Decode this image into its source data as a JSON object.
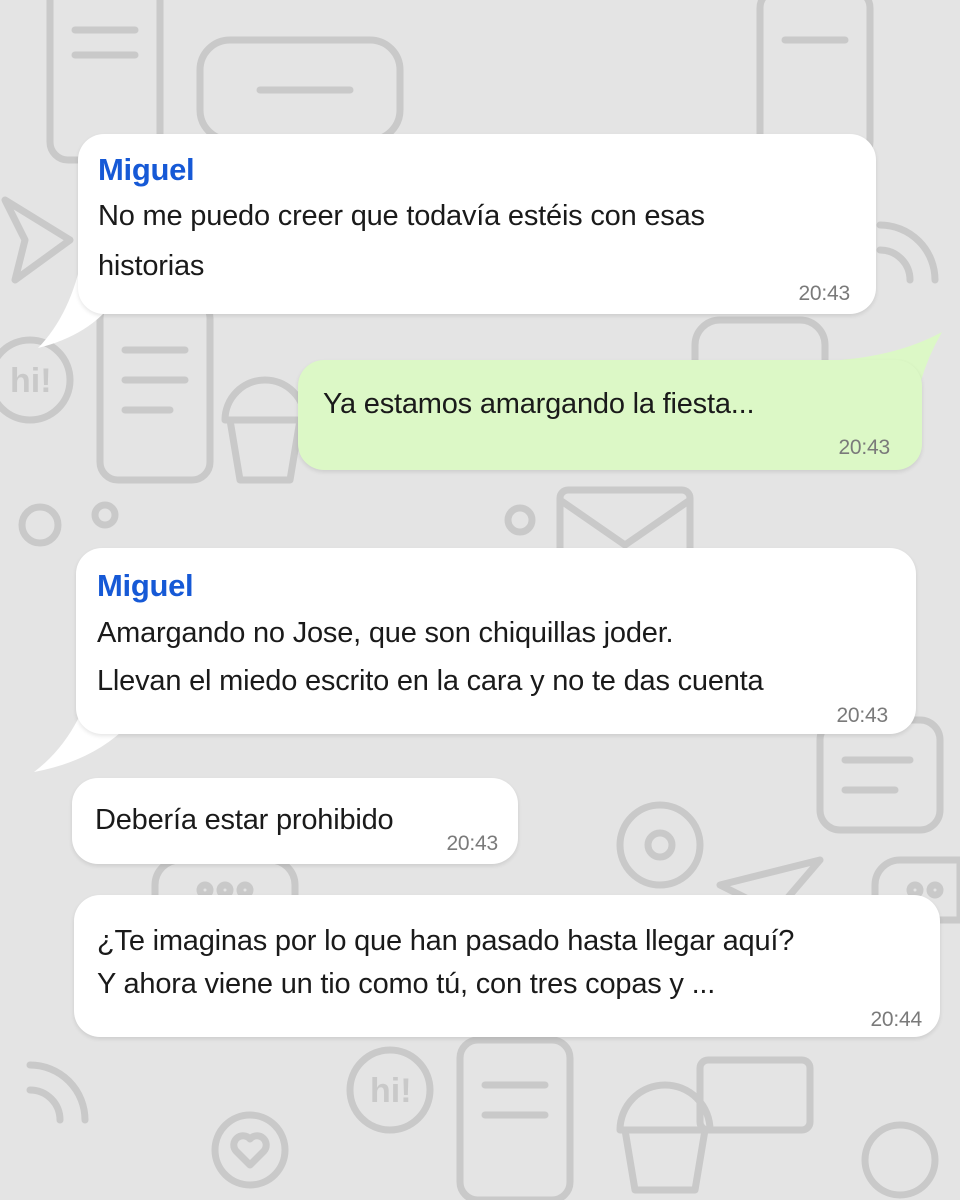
{
  "chat": {
    "messages": [
      {
        "sender": "Miguel",
        "lines": [
          "No me puedo creer que todavía estéis con esas",
          "historias"
        ],
        "time": "20:43"
      },
      {
        "lines": [
          "Ya estamos amargando la fiesta..."
        ],
        "time": "20:43"
      },
      {
        "sender": "Miguel",
        "lines": [
          "Amargando no Jose, que son chiquillas joder.",
          "Llevan el miedo escrito en la cara y no te das cuenta"
        ],
        "time": "20:43"
      },
      {
        "lines": [
          "Debería estar prohibido"
        ],
        "time": "20:43"
      },
      {
        "lines": [
          "¿Te imaginas por lo que han pasado hasta llegar aquí?",
          "Y ahora viene un tio como tú, con tres copas y ..."
        ],
        "time": "20:44"
      }
    ]
  },
  "colors": {
    "wallpaper": "#e4e4e4",
    "doodle_stroke": "#c9c9c9",
    "incoming_bubble": "#ffffff",
    "outgoing_bubble": "#dcf8c6",
    "sender_name": "#1659d6",
    "timestamp": "#7a7a7a"
  },
  "wallpaper_icons": [
    "phone-icon",
    "chat-bubble-icon",
    "paper-plane-icon",
    "hi-bubble-icon",
    "envelope-icon",
    "heart-bubble-icon",
    "cupcake-icon",
    "at-sign-icon",
    "wifi-signal-icon"
  ]
}
